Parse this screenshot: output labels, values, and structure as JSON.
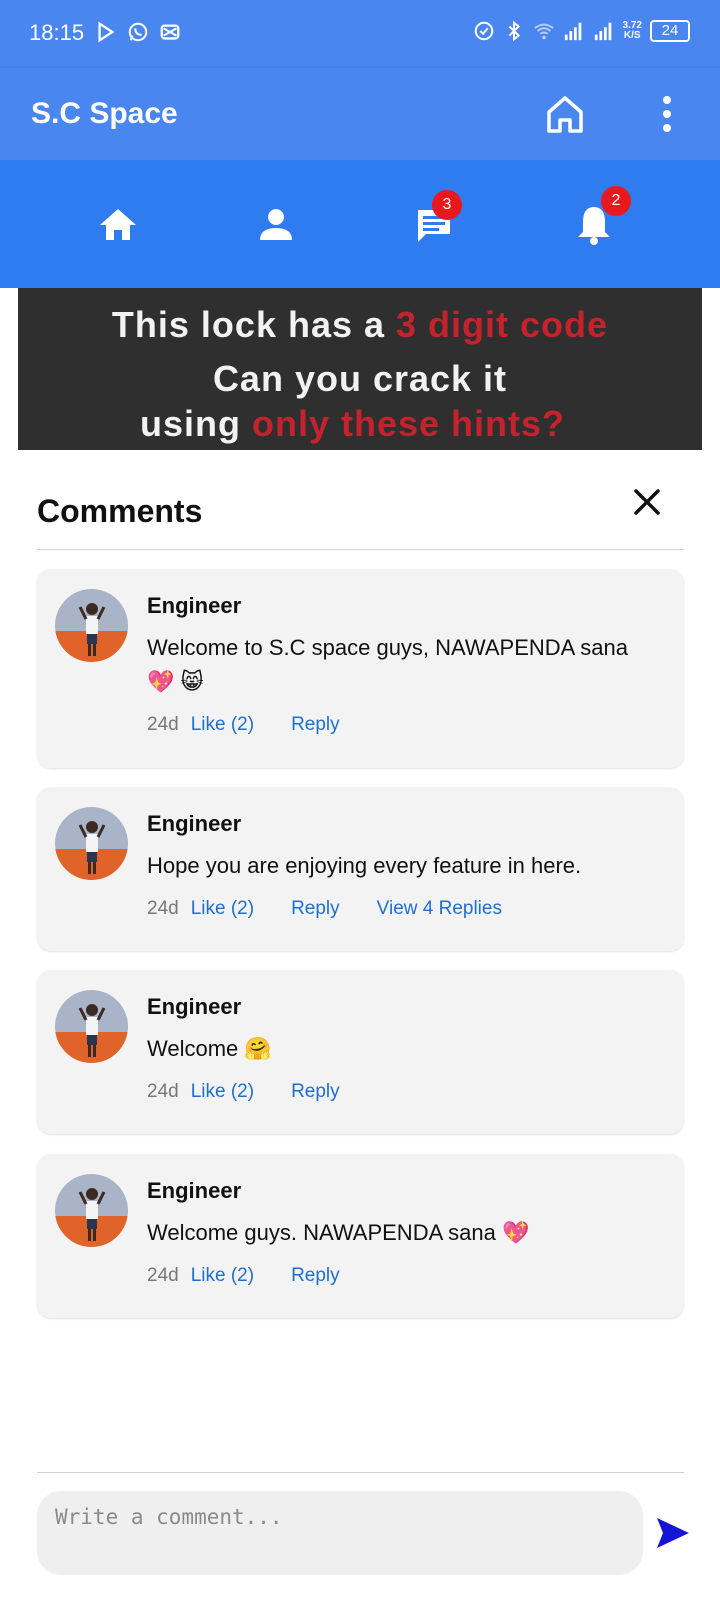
{
  "status_bar": {
    "time": "18:15",
    "speed_top": "3.72",
    "speed_bottom": "K/S",
    "battery": "24"
  },
  "app_bar": {
    "title": "S.C Space",
    "home_icon": "home-outline-icon",
    "menu_icon": "more-vertical-icon"
  },
  "nav": {
    "items": [
      {
        "name": "home",
        "icon": "home-icon"
      },
      {
        "name": "profile",
        "icon": "person-icon"
      },
      {
        "name": "messages",
        "icon": "chat-icon",
        "badge": "3"
      },
      {
        "name": "notifications",
        "icon": "bell-icon",
        "badge": "2"
      }
    ]
  },
  "post": {
    "line1_a": "This lock has a ",
    "line1_b": "3 digit code",
    "line2": "Can you crack it",
    "line3_a": "using ",
    "line3_b": "only these hints?"
  },
  "comments_sheet": {
    "title": "Comments",
    "comments": [
      {
        "author": "Engineer",
        "text": "Welcome to S.C space guys, NAWAPENDA sana 💖 😸",
        "time": "24d",
        "like": "Like (2)",
        "reply": "Reply"
      },
      {
        "author": "Engineer",
        "text": "Hope you are enjoying every feature in here.",
        "time": "24d",
        "like": "Like (2)",
        "reply": "Reply",
        "view_replies": "View 4 Replies"
      },
      {
        "author": "Engineer",
        "text": "Welcome 🤗",
        "time": "24d",
        "like": "Like (2)",
        "reply": "Reply"
      },
      {
        "author": "Engineer",
        "text": "Welcome guys. NAWAPENDA sana 💖",
        "time": "24d",
        "like": "Like (2)",
        "reply": "Reply"
      }
    ],
    "input_placeholder": "Write a comment..."
  },
  "colors": {
    "app_bar": "#4a86f0",
    "nav_bar": "#2f7bf0",
    "badge": "#e8191e",
    "link": "#1e6fd0",
    "send": "#1515d8"
  }
}
